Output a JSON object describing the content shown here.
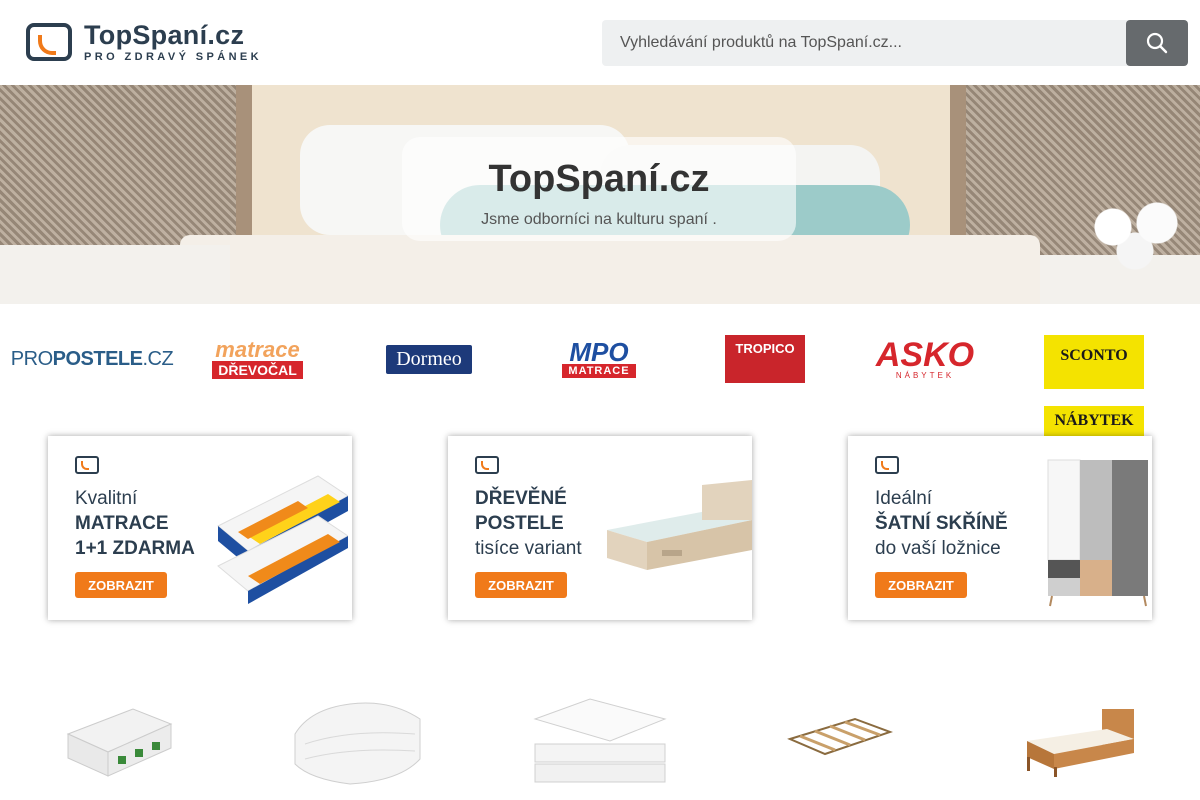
{
  "header": {
    "logo_name": "TopSpaní.cz",
    "logo_tagline": "PRO ZDRAVÝ SPÁNEK",
    "search_placeholder": "Vyhledávání produktů na TopSpaní.cz..."
  },
  "hero": {
    "title": "TopSpaní.cz",
    "subtitle": "Jsme odborníci na kulturu spaní ."
  },
  "brands": {
    "propostele": {
      "pre": "PRO",
      "main": "POSTELE",
      "suffix": ".CZ"
    },
    "drevocal": {
      "top": "matrace",
      "bottom": "DŘEVOČAL"
    },
    "dormeo": "Dormeo",
    "mpo": {
      "top": "MPO",
      "bottom": "MATRACE"
    },
    "tropico": "TROPICO",
    "asko": {
      "top": "ASKO",
      "bottom": "NÁBYTEK"
    },
    "sconto": {
      "top": "SCONTO",
      "bottom": "NÁBYTEK"
    }
  },
  "promos": [
    {
      "line1": "Kvalitní",
      "line2": "MATRACE",
      "line3": "1+1 ZDARMA",
      "button": "ZOBRAZIT"
    },
    {
      "line1": "DŘEVĚNÉ",
      "line2": "POSTELE",
      "line3": "tisíce variant",
      "button": "ZOBRAZIT"
    },
    {
      "line1": "Ideální",
      "line2": "ŠATNÍ SKŘÍNĚ",
      "line3": "do vaší ložnice",
      "button": "ZOBRAZIT"
    }
  ],
  "colors": {
    "brand_dark": "#2c3e4f",
    "brand_orange": "#f07a1a",
    "search_button": "#666a6d"
  }
}
